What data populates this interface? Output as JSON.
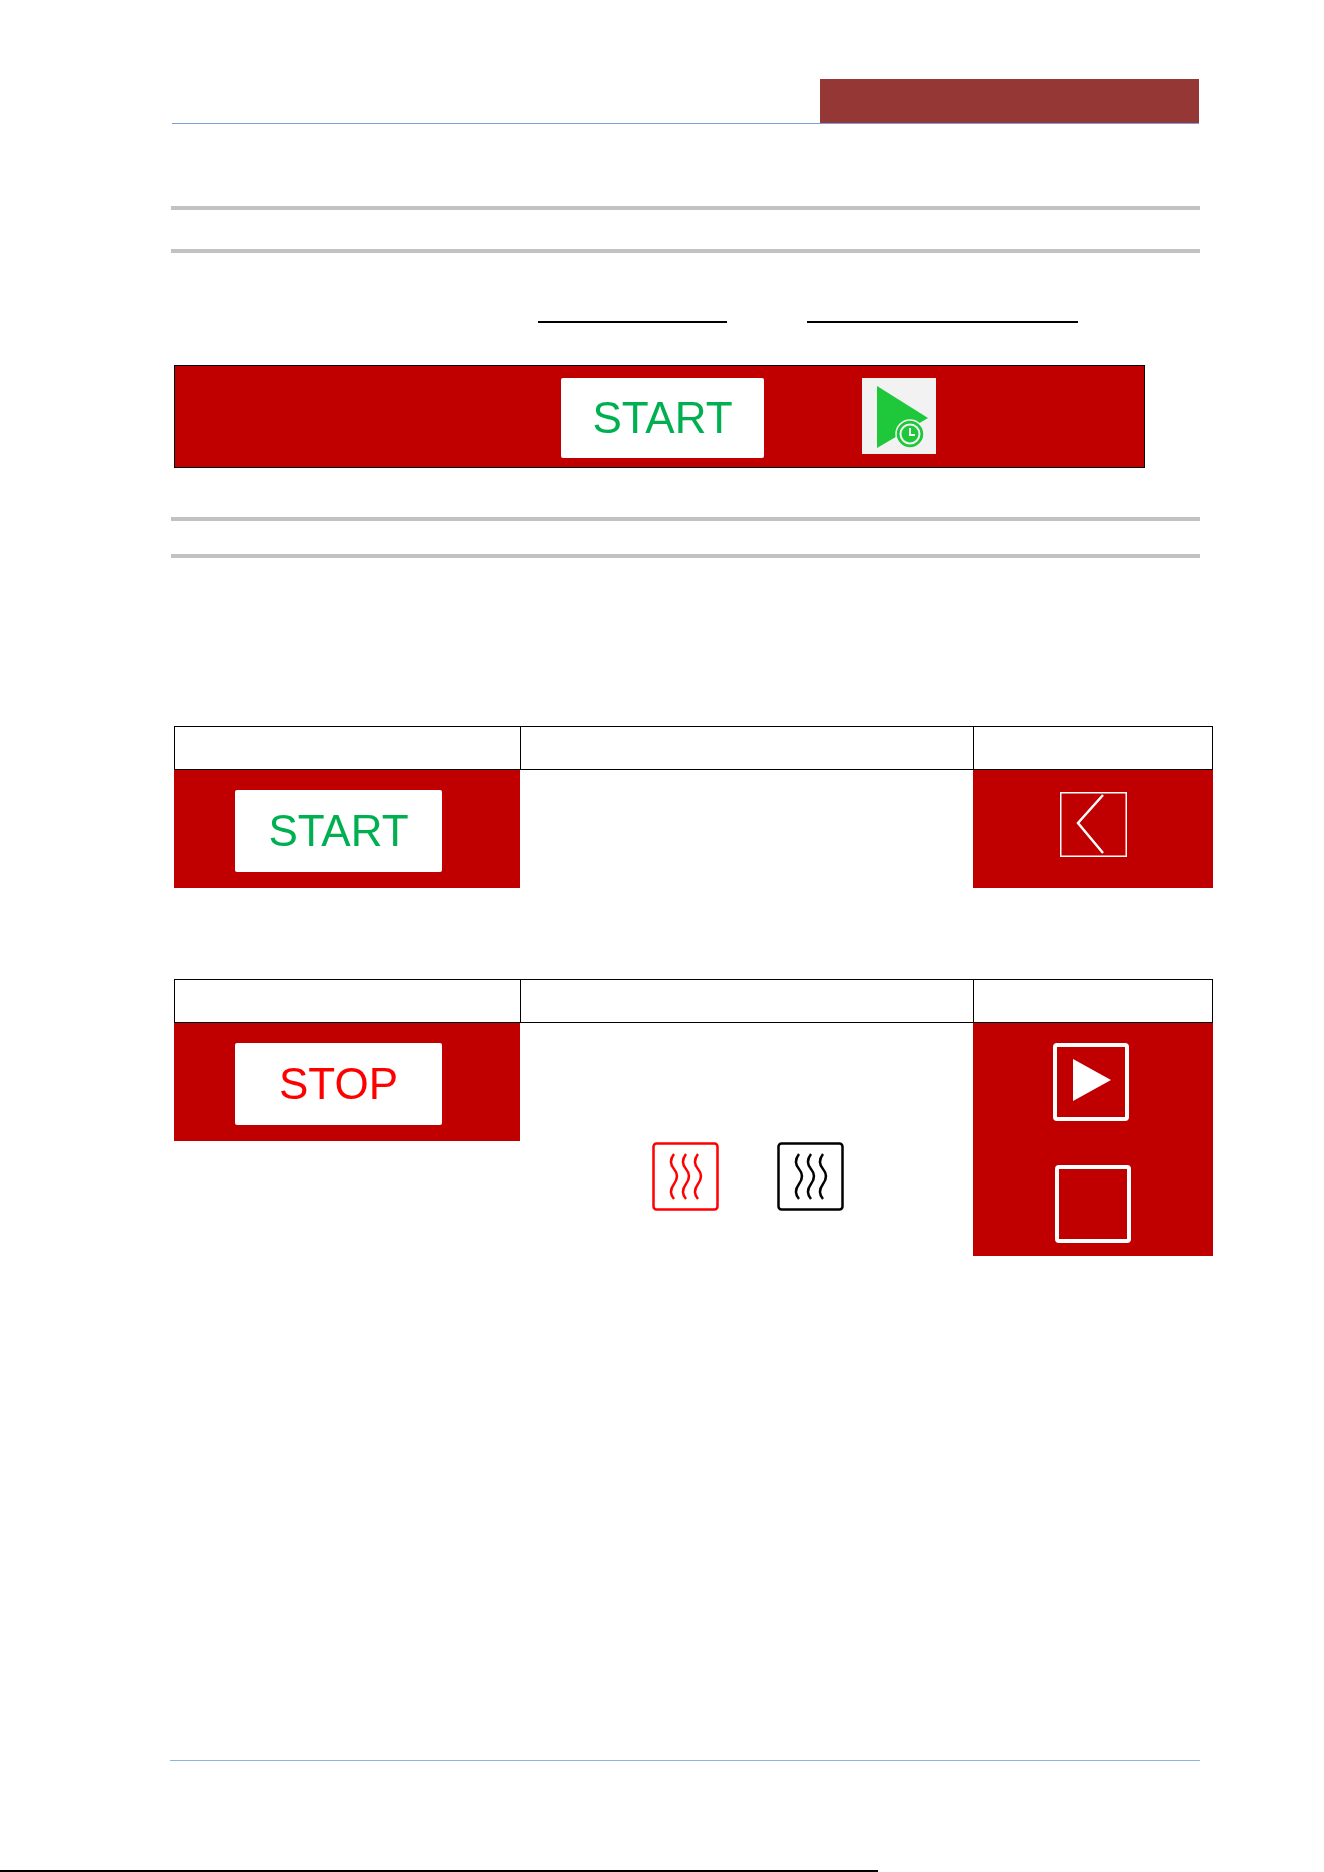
{
  "control_bar": {
    "button": {
      "label": "START",
      "kind": "start"
    }
  },
  "tables": [
    {
      "button": {
        "label": "START",
        "kind": "start"
      }
    },
    {
      "button": {
        "label": "STOP",
        "kind": "stop"
      }
    }
  ]
}
